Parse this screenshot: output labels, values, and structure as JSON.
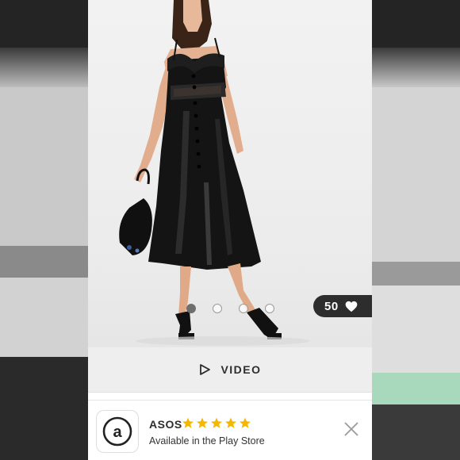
{
  "product": {
    "image_alt": "Model wearing black satin midi slip dress with lace trim",
    "carousel": {
      "count": 4,
      "active_index": 0
    },
    "saves_count": "50"
  },
  "video_button": {
    "label": "VIDEO"
  },
  "app_banner": {
    "app_name": "ASOS",
    "rating_stars": 5,
    "store_text": "Available in the Play Store"
  },
  "colors": {
    "star": "#f5b800",
    "saves_pill": "#2d2d2d",
    "video_bar": "#eeeeee",
    "text_dark": "#2d2d2d"
  }
}
